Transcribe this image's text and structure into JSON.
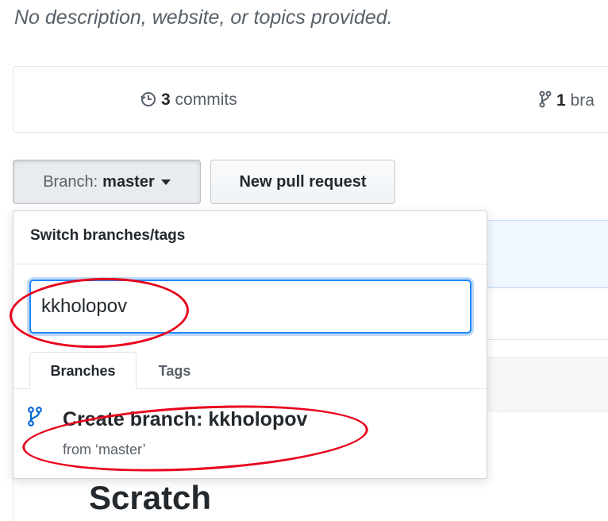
{
  "repo": {
    "description": "No description, website, or topics provided.",
    "stats": {
      "commits_count": "3",
      "commits_label": "commits",
      "branches_count": "1",
      "branches_label": "bra"
    },
    "readme_title": "Scratch"
  },
  "toolbar": {
    "branch_label": "Branch:",
    "branch_value": "master",
    "new_pr_label": "New pull request"
  },
  "branch_dropdown": {
    "header": "Switch branches/tags",
    "filter_value": "kkholopov",
    "tabs": [
      {
        "label": "Branches",
        "active": true
      },
      {
        "label": "Tags",
        "active": false
      }
    ],
    "create": {
      "title": "Create branch: kkholopov",
      "subtitle": "from ‘master’"
    }
  },
  "colors": {
    "accent_focus": "#2188ff",
    "annotation": "#e8001c",
    "branch_icon": "#0366d6"
  },
  "icons": {
    "commits": "history-icon",
    "branches": "git-branch-icon",
    "create": "git-branch-icon",
    "caret": "caret-down-icon"
  }
}
